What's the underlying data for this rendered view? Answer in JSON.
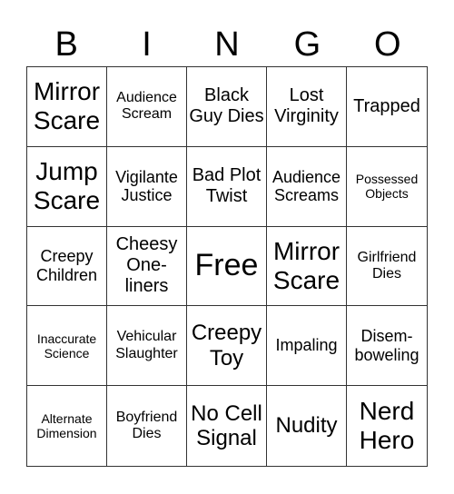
{
  "header": {
    "letters": [
      "B",
      "I",
      "N",
      "G",
      "O"
    ]
  },
  "cells": [
    {
      "text": "Mirror Scare",
      "size": "xl"
    },
    {
      "text": "Audience Scream",
      "size": "s"
    },
    {
      "text": "Black Guy Dies",
      "size": "ml"
    },
    {
      "text": "Lost Virginity",
      "size": "ml"
    },
    {
      "text": "Trapped",
      "size": "ml"
    },
    {
      "text": "Jump Scare",
      "size": "xl"
    },
    {
      "text": "Vigilante Justice",
      "size": "m"
    },
    {
      "text": "Bad Plot Twist",
      "size": "ml"
    },
    {
      "text": "Audience Screams",
      "size": "m"
    },
    {
      "text": "Possessed Objects",
      "size": "xs"
    },
    {
      "text": "Creepy Children",
      "size": "m"
    },
    {
      "text": "Cheesy One-liners",
      "size": "ml"
    },
    {
      "text": "Free",
      "size": "free"
    },
    {
      "text": "Mirror Scare",
      "size": "xl"
    },
    {
      "text": "Girlfriend Dies",
      "size": "s"
    },
    {
      "text": "Inaccurate Science",
      "size": "xs"
    },
    {
      "text": "Vehicular Slaughter",
      "size": "s"
    },
    {
      "text": "Creepy Toy",
      "size": "l"
    },
    {
      "text": "Impaling",
      "size": "m"
    },
    {
      "text": "Disem-boweling",
      "size": "m"
    },
    {
      "text": "Alternate Dimension",
      "size": "xs"
    },
    {
      "text": "Boyfriend Dies",
      "size": "s"
    },
    {
      "text": "No Cell Signal",
      "size": "l"
    },
    {
      "text": "Nudity",
      "size": "l"
    },
    {
      "text": "Nerd Hero",
      "size": "xl"
    }
  ]
}
